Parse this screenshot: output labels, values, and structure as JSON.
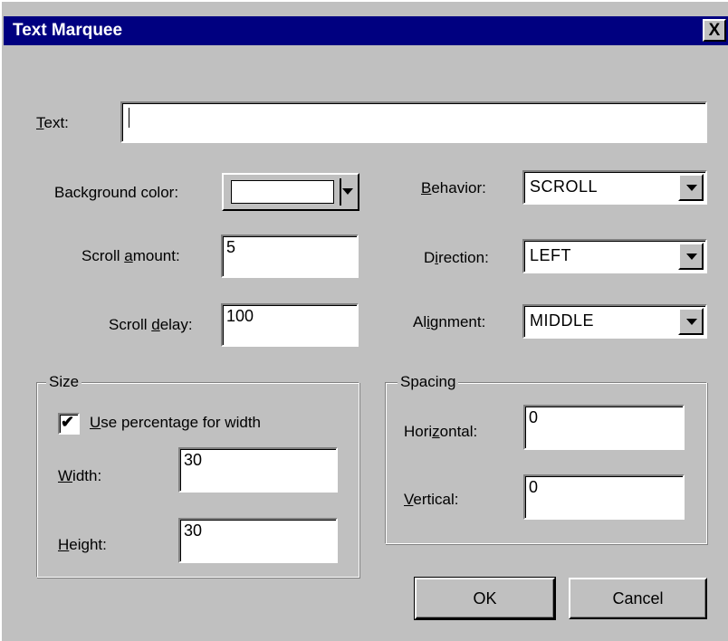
{
  "dialog": {
    "title": "Text Marquee",
    "close_glyph": "X"
  },
  "fields": {
    "text": {
      "label_underlined": "T",
      "label_rest": "ext:",
      "value": ""
    },
    "background_color": {
      "label_pre": "Back",
      "label_underlined": "g",
      "label_post": "round color:",
      "color": "#ffffff"
    },
    "scroll_amount": {
      "label_pre": "Scroll ",
      "label_underlined": "a",
      "label_post": "mount:",
      "value": "5"
    },
    "scroll_delay": {
      "label_pre": "Scroll ",
      "label_underlined": "d",
      "label_post": "elay:",
      "value": "100"
    },
    "behavior": {
      "label_underlined": "B",
      "label_rest": "ehavior:",
      "value": "SCROLL"
    },
    "direction": {
      "label_pre": "D",
      "label_underlined": "i",
      "label_post": "rection:",
      "value": "LEFT"
    },
    "alignment": {
      "label_pre": "Al",
      "label_underlined": "i",
      "label_post": "gnment:",
      "value": "MIDDLE"
    }
  },
  "size_group": {
    "legend": "Size",
    "use_percentage": {
      "label_underlined": "U",
      "label_rest": "se percentage for width",
      "checked": true,
      "check_glyph": "✔"
    },
    "width": {
      "label_underlined": "W",
      "label_rest": "idth:",
      "value": "30"
    },
    "height": {
      "label_underlined": "H",
      "label_rest": "eight:",
      "value": "30"
    }
  },
  "spacing_group": {
    "legend": "Spacing",
    "horizontal": {
      "label_pre": "Hori",
      "label_underlined": "z",
      "label_post": "ontal:",
      "value": "0"
    },
    "vertical": {
      "label_underlined": "V",
      "label_rest": "ertical:",
      "value": "0"
    }
  },
  "buttons": {
    "ok": "OK",
    "cancel": "Cancel"
  }
}
